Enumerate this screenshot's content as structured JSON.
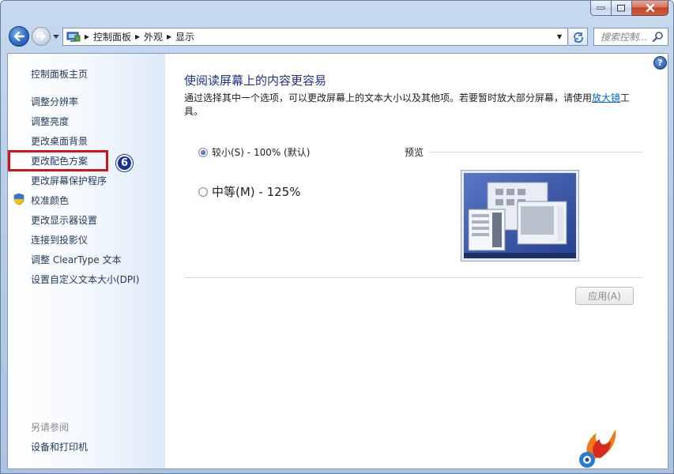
{
  "window": {
    "caption_buttons": [
      "minimize",
      "maximize",
      "close"
    ]
  },
  "navbar": {
    "breadcrumbs": [
      "控制面板",
      "外观",
      "显示"
    ],
    "search_placeholder": "搜索控制..."
  },
  "sidebar": {
    "home": "控制面板主页",
    "items": [
      {
        "label": "调整分辨率"
      },
      {
        "label": "调整亮度"
      },
      {
        "label": "更改桌面背景"
      },
      {
        "label": "更改配色方案"
      },
      {
        "label": "更改屏幕保护程序"
      },
      {
        "label": "校准颜色",
        "icon": "shield-icon"
      },
      {
        "label": "更改显示器设置"
      },
      {
        "label": "连接到投影仪"
      },
      {
        "label": "调整 ClearType 文本"
      },
      {
        "label": "设置自定义文本大小(DPI)"
      }
    ],
    "see_also": "另请参阅",
    "see_also_items": [
      "设备和打印机"
    ],
    "step_badge": "6",
    "highlight_color": "#d3141a"
  },
  "main": {
    "title": "使阅读屏幕上的内容更容易",
    "desc_before": "通过选择其中一个选项，可以更改屏幕上的文本大小以及其他项。若要暂时放大部分屏幕，请使用",
    "desc_link": "放大镜",
    "desc_after": "工具。",
    "options": [
      {
        "label": "较小(S) - 100% (默认)",
        "selected": true
      },
      {
        "label": "中等(M) - 125%",
        "selected": false
      }
    ],
    "preview_label": "预览",
    "apply_label": "应用(A)"
  },
  "colors": {
    "title": "#1e3287",
    "link": "#0066cc",
    "badge": "#1b2f9c"
  }
}
